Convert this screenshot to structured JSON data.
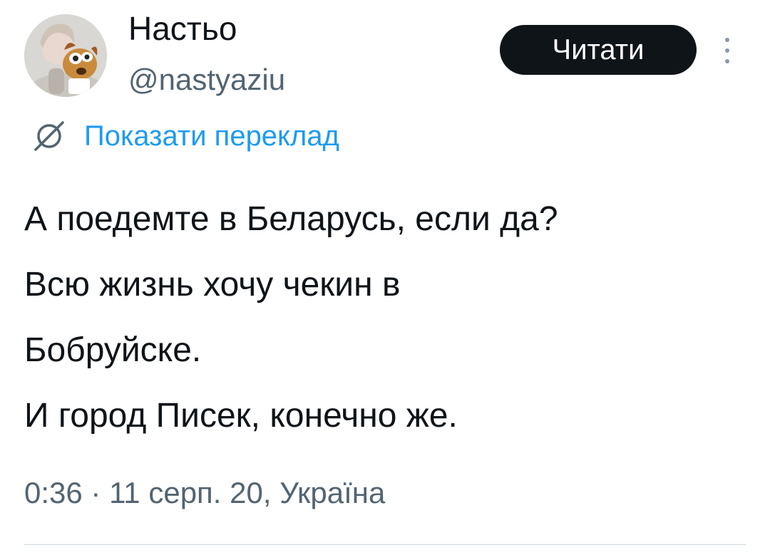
{
  "author": {
    "display_name": "Настьо",
    "handle": "@nastyaziu",
    "avatar_icon": "profile-photo"
  },
  "actions": {
    "follow_label": "Читати",
    "more_icon": "vertical-ellipsis-icon"
  },
  "translate": {
    "icon": "globe-icon",
    "label": "Показати переклад"
  },
  "tweet": {
    "lines": [
      "А поедемте в Беларусь, если да?",
      "Всю жизнь хочу чекин в",
      "Бобруйске.",
      "И город Писек, конечно же."
    ]
  },
  "meta": {
    "timestamp": "0:36 · 11 серп. 20, Україна"
  },
  "colors": {
    "text": "#0f1419",
    "secondary": "#536471",
    "link": "#1d9bf0",
    "button_bg": "#0f1419",
    "button_text": "#ffffff"
  }
}
